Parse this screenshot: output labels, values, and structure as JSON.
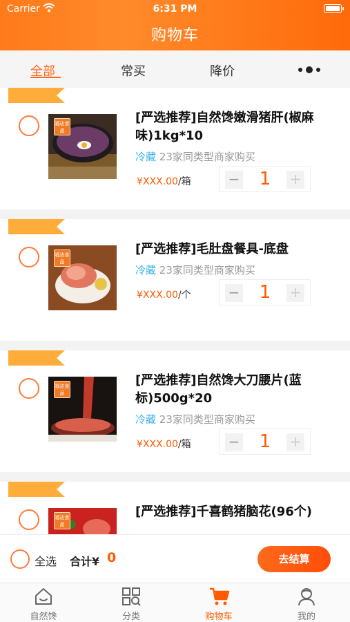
{
  "status_bar": {
    "carrier": "Carrier",
    "time": "6:31 PM"
  },
  "header": {
    "title": "购物车"
  },
  "tabs": [
    {
      "label": "全部",
      "active": true
    },
    {
      "label": "常买",
      "active": false
    },
    {
      "label": "降价",
      "active": false
    }
  ],
  "more_icon": "more-dots-icon",
  "items": [
    {
      "name": "[严选推荐]自然馋嫩滑猪肝(椒麻味)1kg*10",
      "storage": "冷藏",
      "buyers": "23家同类型商家购买",
      "price": "¥XXX.00",
      "unit": "/箱",
      "qty": "1",
      "badge": "福达食品"
    },
    {
      "name": "[严选推荐]毛肚盘餐具-底盘",
      "storage": "冷藏",
      "buyers": "23家同类型商家购买",
      "price": "¥XXX.00",
      "unit": "/个",
      "qty": "1",
      "badge": "福达食品"
    },
    {
      "name": "[严选推荐]自然馋大刀腰片(蓝标)500g*20",
      "storage": "冷藏",
      "buyers": "23家同类型商家购买",
      "price": "¥XXX.00",
      "unit": "/箱",
      "qty": "1",
      "badge": "福达食品"
    },
    {
      "name": "[严选推荐]千喜鹤猪脑花(96个)",
      "badge": "福达食品"
    }
  ],
  "stepper": {
    "minus": "−",
    "plus": "+"
  },
  "checkout": {
    "select_all": "全选",
    "total_label": "合计¥",
    "total_amount": "0",
    "button": "去结算"
  },
  "tabbar": [
    {
      "label": "自然馋",
      "icon": "home-icon",
      "active": false
    },
    {
      "label": "分类",
      "icon": "category-icon",
      "active": false
    },
    {
      "label": "购物车",
      "icon": "cart-icon",
      "active": true
    },
    {
      "label": "我的",
      "icon": "profile-icon",
      "active": false
    }
  ],
  "colors": {
    "brand": "#ff6a1a",
    "price": "#ff5a00",
    "storage": "#3ab4e6"
  }
}
